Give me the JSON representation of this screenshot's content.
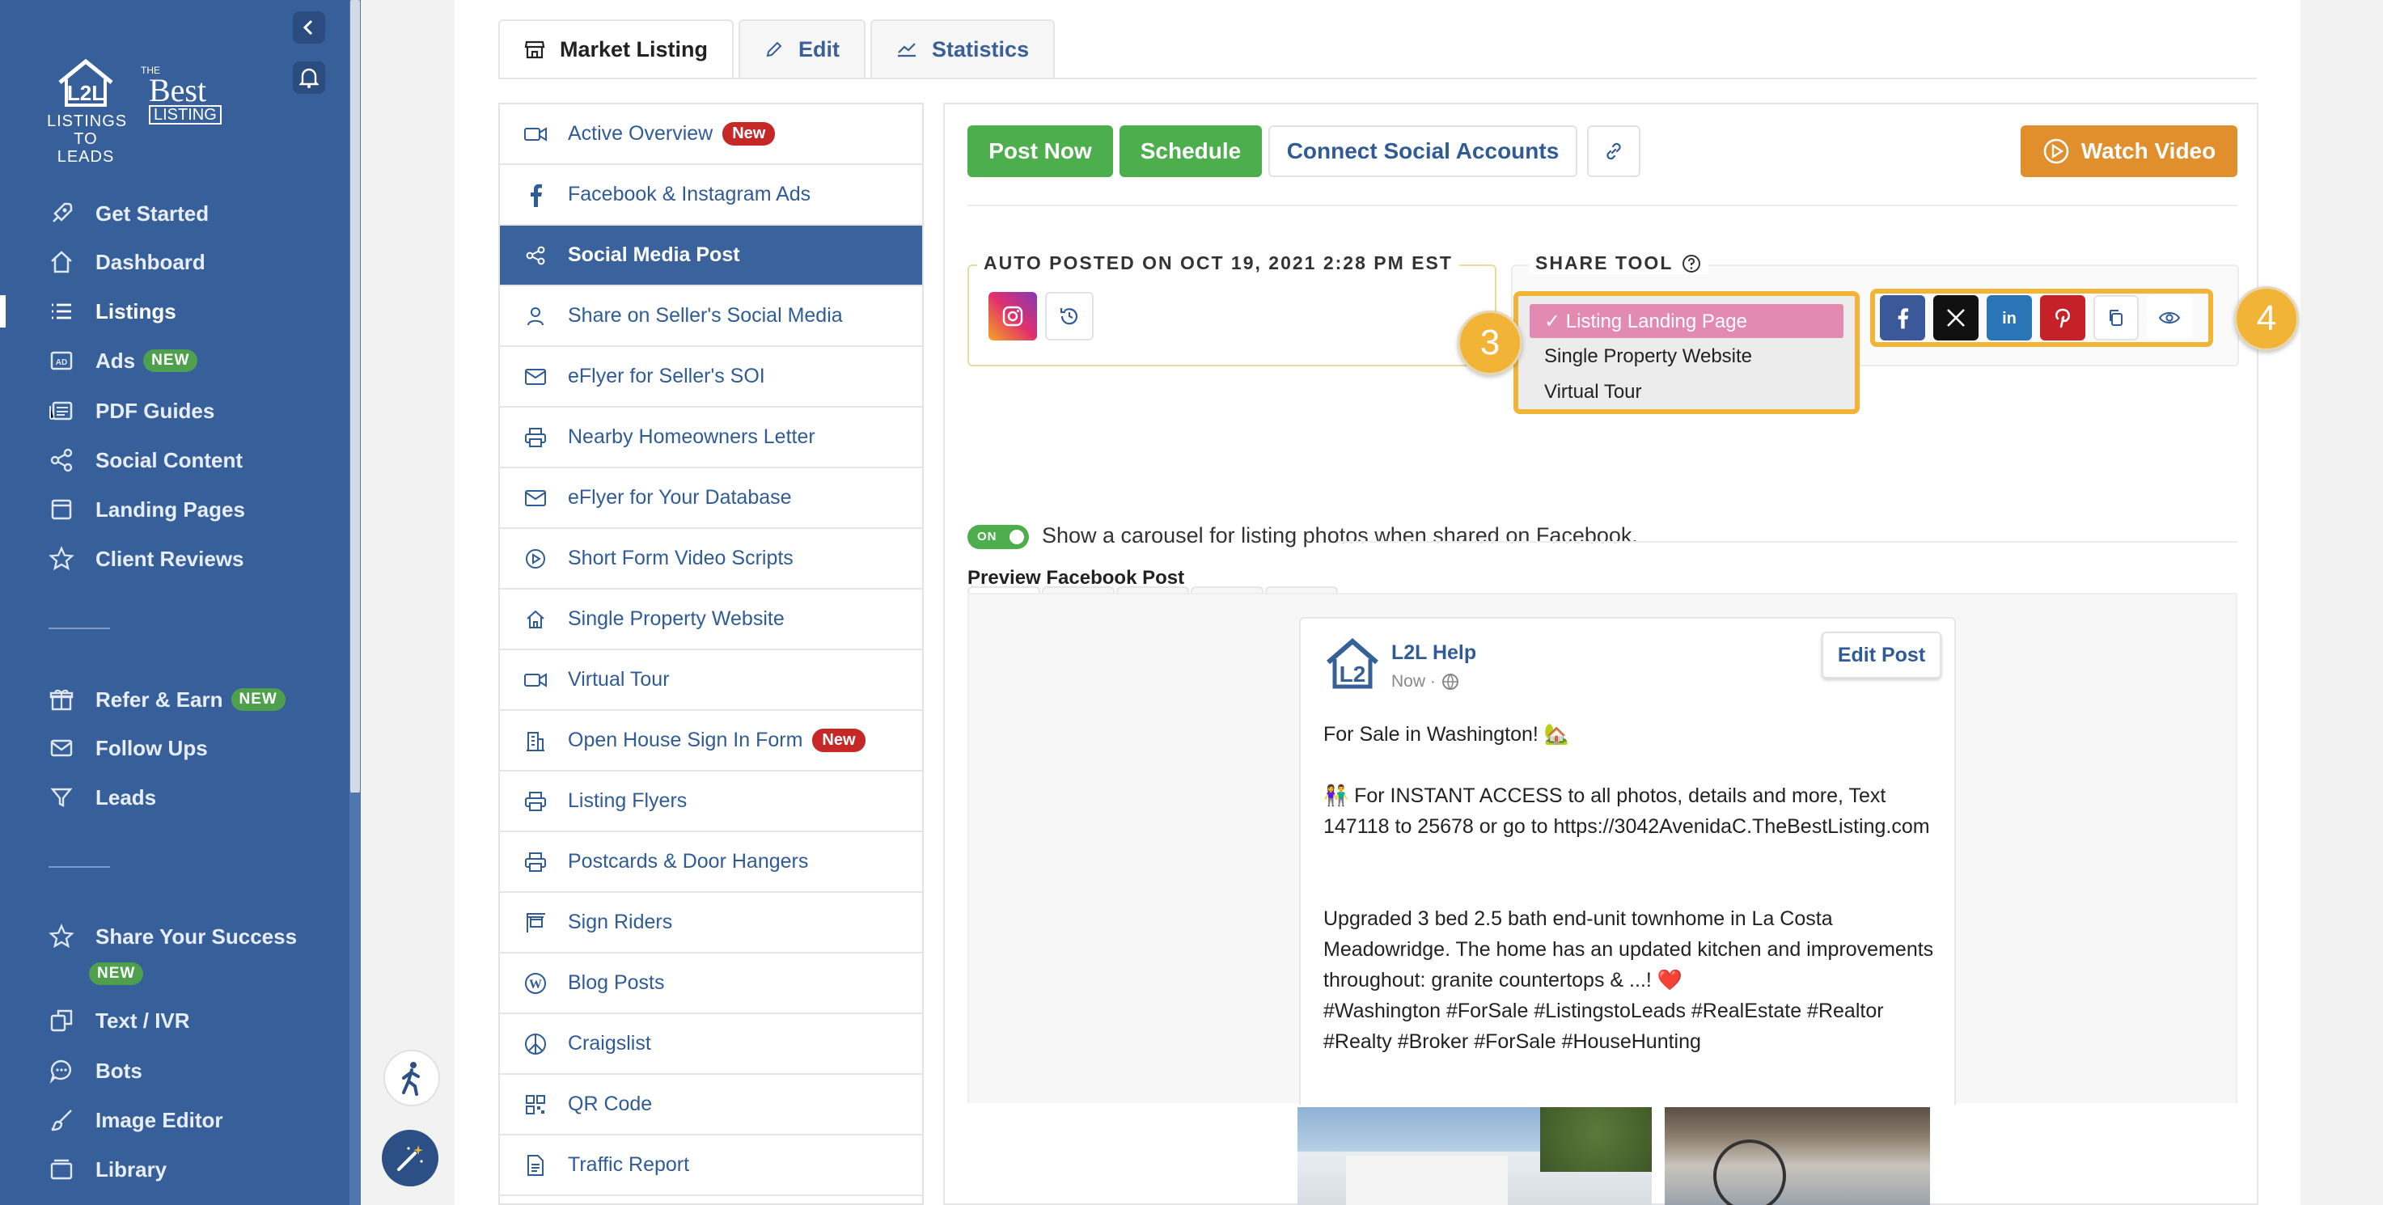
{
  "sidebar": {
    "logo_primary": "LISTINGS TO LEADS",
    "logo_primary_line1": "LISTINGS",
    "logo_primary_line2": "TO LEADS",
    "logo_secondary_the": "THE",
    "logo_secondary_best": "Best",
    "logo_secondary_listing": "LISTING",
    "items": [
      {
        "label": "Get Started",
        "icon": "rocket-icon"
      },
      {
        "label": "Dashboard",
        "icon": "home-icon"
      },
      {
        "label": "Listings",
        "icon": "list-icon",
        "active": true
      },
      {
        "label": "Ads",
        "icon": "ad-icon",
        "badge": "NEW"
      },
      {
        "label": "PDF Guides",
        "icon": "newspaper-icon"
      },
      {
        "label": "Social Content",
        "icon": "share-icon"
      },
      {
        "label": "Landing Pages",
        "icon": "page-icon"
      },
      {
        "label": "Client Reviews",
        "icon": "star-icon"
      }
    ],
    "items2": [
      {
        "label": "Refer & Earn",
        "icon": "gift-icon",
        "badge": "NEW"
      },
      {
        "label": "Follow Ups",
        "icon": "mail-icon"
      },
      {
        "label": "Leads",
        "icon": "filter-icon"
      }
    ],
    "items3": [
      {
        "label": "Share Your Success",
        "icon": "star-icon",
        "badge": "NEW"
      },
      {
        "label": "Text / IVR",
        "icon": "ivr-icon"
      },
      {
        "label": "Bots",
        "icon": "chat-icon"
      },
      {
        "label": "Image Editor",
        "icon": "brush-icon"
      },
      {
        "label": "Library",
        "icon": "library-icon"
      }
    ]
  },
  "tabs": [
    {
      "label": "Market Listing",
      "icon": "storefront-icon",
      "active": true
    },
    {
      "label": "Edit",
      "icon": "pencil-icon"
    },
    {
      "label": "Statistics",
      "icon": "chart-line-icon"
    }
  ],
  "submenu": [
    {
      "label": "Active Overview",
      "icon": "video-icon",
      "badge": "New"
    },
    {
      "label": "Facebook & Instagram Ads",
      "icon": "facebook-icon"
    },
    {
      "label": "Social Media Post",
      "icon": "share-icon",
      "active": true
    },
    {
      "label": "Share on Seller's Social Media",
      "icon": "user-icon"
    },
    {
      "label": "eFlyer for Seller's SOI",
      "icon": "mail-icon"
    },
    {
      "label": "Nearby Homeowners Letter",
      "icon": "printer-icon"
    },
    {
      "label": "eFlyer for Your Database",
      "icon": "mail-icon"
    },
    {
      "label": "Short Form Video Scripts",
      "icon": "play-circle-icon"
    },
    {
      "label": "Single Property Website",
      "icon": "home-icon"
    },
    {
      "label": "Virtual Tour",
      "icon": "video-icon"
    },
    {
      "label": "Open House Sign In Form",
      "icon": "building-icon",
      "badge": "New"
    },
    {
      "label": " Listing Flyers",
      "icon": "printer-icon"
    },
    {
      "label": "Postcards & Door Hangers",
      "icon": "printer-icon"
    },
    {
      "label": "Sign Riders",
      "icon": "sign-icon"
    },
    {
      "label": "Blog Posts",
      "icon": "wordpress-icon"
    },
    {
      "label": "Craigslist",
      "icon": "peace-icon"
    },
    {
      "label": "QR Code",
      "icon": "qr-icon"
    },
    {
      "label": "Traffic Report",
      "icon": "document-icon"
    }
  ],
  "actions": {
    "post_now": "Post Now",
    "schedule": "Schedule",
    "connect": "Connect Social Accounts",
    "watch_video": "Watch Video"
  },
  "auto_posted": {
    "label": "AUTO POSTED ON OCT 19, 2021 2:28 PM EST"
  },
  "share_tool": {
    "label": "SHARE TOOL",
    "options": [
      "Listing Landing Page",
      "Single Property Website",
      "Virtual Tour"
    ],
    "selected": "✓ Listing Landing Page",
    "callout_left": "3",
    "callout_right": "4"
  },
  "carousel": {
    "toggle_label": "ON",
    "text": "Show a carousel for listing photos when shared on Facebook."
  },
  "preview": {
    "title": "Preview Facebook Post",
    "page_name": "L2L Help",
    "time": "Now ·",
    "edit_button": "Edit Post",
    "line1": "For Sale in Washington! 🏡",
    "line2": "👫 For INSTANT ACCESS to all photos, details and more, Text 147118 to 25678 or go to https://3042AvenidaC.TheBestListing.com",
    "line3": "Upgraded 3 bed 2.5 bath end-unit townhome in La Costa Meadowridge. The home has an updated kitchen and improvements throughout: granite countertops & ...! ❤️",
    "line4": "#Washington #ForSale #ListingstoLeads #RealEstate #Realtor #Realty #Broker #ForSale #HouseHunting"
  },
  "colors": {
    "sidebar": "#37609a",
    "green": "#4cae4c",
    "orange": "#e08f2c",
    "callout": "#f2b437",
    "selected_option": "#e38ab3"
  }
}
